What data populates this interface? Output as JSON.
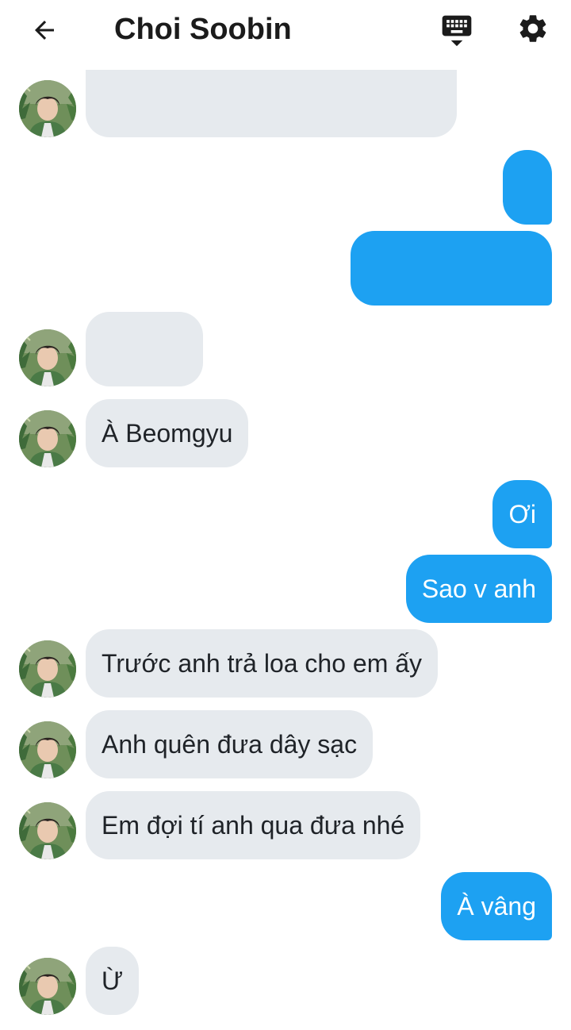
{
  "header": {
    "title": "Choi Soobin"
  },
  "icons": {
    "back": "arrow-left-icon",
    "keyboard": "keyboard-hide-icon",
    "settings": "gear-icon"
  },
  "colors": {
    "incoming_bubble": "#e6eaee",
    "outgoing_bubble": "#1da1f2",
    "text_dark": "#1f2328",
    "text_light": "#ffffff"
  },
  "messages": [
    {
      "from": "contact",
      "text": ""
    },
    {
      "from": "me",
      "text": ""
    },
    {
      "from": "me",
      "text": ""
    },
    {
      "from": "contact",
      "text": ""
    },
    {
      "from": "contact",
      "text": "À Beomgyu"
    },
    {
      "from": "me",
      "text": "Ơi"
    },
    {
      "from": "me",
      "text": "Sao v anh"
    },
    {
      "from": "contact",
      "text": "Trước anh trả loa cho em ấy"
    },
    {
      "from": "contact",
      "text": "Anh quên đưa dây sạc"
    },
    {
      "from": "contact",
      "text": "Em đợi tí anh qua đưa nhé"
    },
    {
      "from": "me",
      "text": "À vâng"
    },
    {
      "from": "contact",
      "text": "Ừ"
    }
  ]
}
